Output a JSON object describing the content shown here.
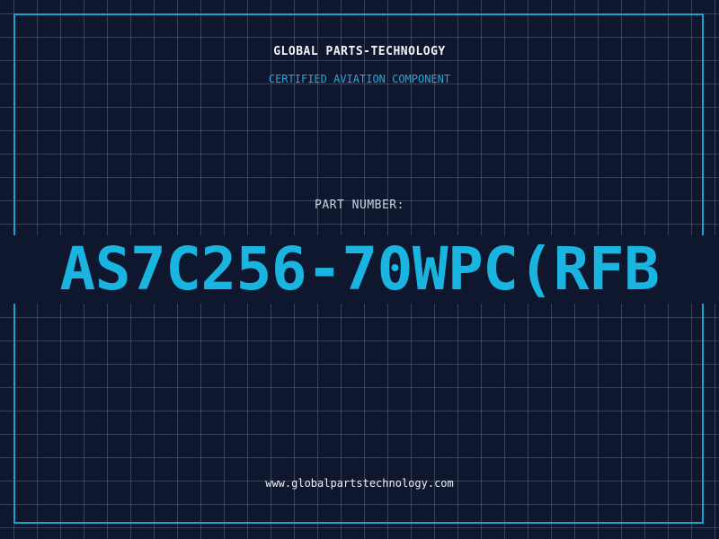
{
  "header": {
    "company": "GLOBAL PARTS-TECHNOLOGY",
    "subtitle": "CERTIFIED AVIATION COMPONENT"
  },
  "part": {
    "label": "PART NUMBER:",
    "number": "AS7C256-70WPC(RFB"
  },
  "footer": {
    "website": "www.globalpartstechnology.com"
  },
  "colors": {
    "background": "#0f172e",
    "grid": "#28789a",
    "accent": "#1ab4e0",
    "text": "#f2f4f8"
  }
}
